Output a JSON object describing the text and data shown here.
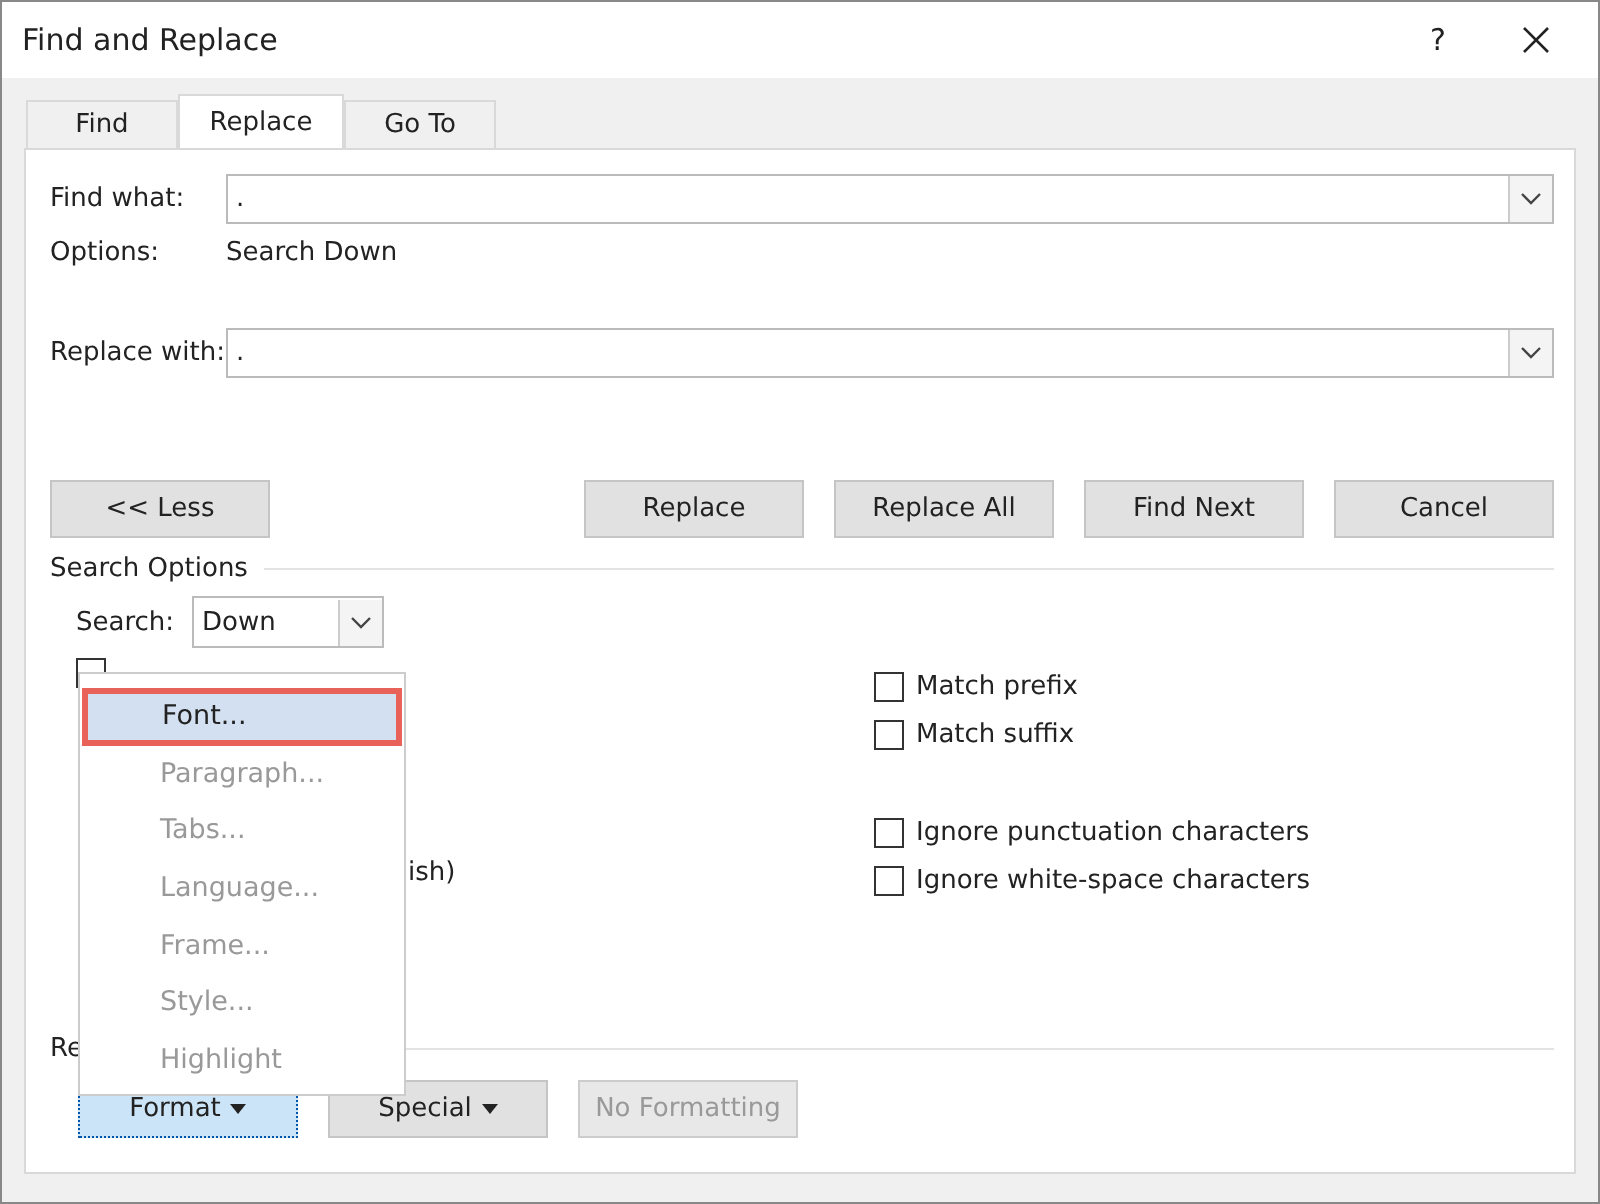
{
  "window": {
    "title": "Find and Replace",
    "help": "?"
  },
  "tabs": [
    {
      "label": "Find",
      "selected": false
    },
    {
      "label": "Replace",
      "selected": true
    },
    {
      "label": "Go To",
      "selected": false
    }
  ],
  "find_what": {
    "label": "Find what:",
    "value": "."
  },
  "options": {
    "label": "Options:",
    "value": "Search Down"
  },
  "replace_with": {
    "label": "Replace with:",
    "value": "."
  },
  "buttons": [
    {
      "label": "<< Less",
      "kind": "left"
    },
    {
      "label": "Replace",
      "kind": "right"
    },
    {
      "label": "Replace All",
      "kind": "right"
    },
    {
      "label": "Find Next",
      "kind": "right"
    },
    {
      "label": "Cancel",
      "kind": "right"
    }
  ],
  "search_options": {
    "title": "Search Options",
    "search_label": "Search:",
    "search_value": "Down"
  },
  "left_options": [
    {
      "kind": "checkbox",
      "checked": false
    },
    {
      "kind": "text",
      "label": "ish)"
    }
  ],
  "right_option_groups": [
    [
      {
        "label": "Match prefix",
        "checked": false
      },
      {
        "label": "Match suffix",
        "checked": false
      }
    ],
    [
      {
        "label": "Ignore punctuation characters",
        "checked": false
      },
      {
        "label": "Ignore white-space characters",
        "checked": false
      }
    ]
  ],
  "replace_section": {
    "label": "Re"
  },
  "bottom_buttons": [
    {
      "label": "Format",
      "caret": true,
      "pressed": true,
      "disabled": false
    },
    {
      "label": "Special",
      "caret": true,
      "pressed": false,
      "disabled": false
    },
    {
      "label": "No Formatting",
      "caret": false,
      "pressed": false,
      "disabled": true
    }
  ],
  "format_menu": [
    {
      "label": "Font...",
      "selected": true,
      "disabled": false
    },
    {
      "label": "Paragraph...",
      "selected": false,
      "disabled": true
    },
    {
      "label": "Tabs...",
      "selected": false,
      "disabled": true
    },
    {
      "label": "Language...",
      "selected": false,
      "disabled": true
    },
    {
      "label": "Frame...",
      "selected": false,
      "disabled": true
    },
    {
      "label": "Style...",
      "selected": false,
      "disabled": true
    },
    {
      "label": "Highlight",
      "selected": false,
      "disabled": true
    }
  ]
}
